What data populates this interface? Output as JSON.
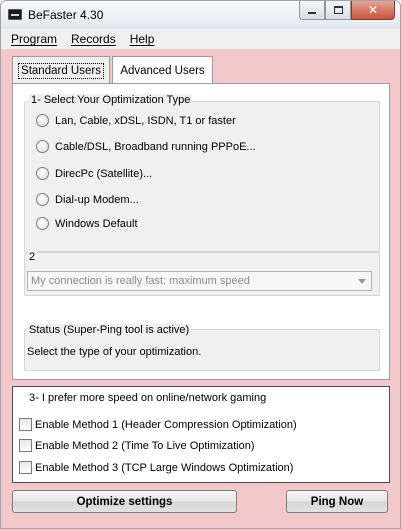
{
  "window": {
    "title": "BeFaster 4.30"
  },
  "menu": {
    "items": [
      "Program",
      "Records",
      "Help"
    ]
  },
  "tabs": [
    {
      "label": "Standard Users"
    },
    {
      "label": "Advanced Users"
    }
  ],
  "optimization": {
    "group_label": "1- Select Your Optimization Type",
    "options": [
      "Lan, Cable, xDSL, ISDN, T1 or faster",
      "Cable/DSL, Broadband running PPPoE...",
      "DirecPc (Satellite)...",
      "Dial-up Modem...",
      "Windows Default"
    ]
  },
  "connection": {
    "group_label": "2",
    "selected": "My connection is really fast: maximum speed"
  },
  "status": {
    "group_label": "Status  (Super-Ping tool is active)",
    "text": "Select the type of your optimization."
  },
  "gaming": {
    "group_label": "3- I prefer more speed on online/network gaming",
    "methods": [
      "Enable Method 1 (Header Compression Optimization)",
      "Enable Method 2 (Time To Live Optimization)",
      "Enable Method 3 (TCP Large Windows Optimization)"
    ]
  },
  "buttons": {
    "optimize": "Optimize settings",
    "ping": "Ping Now"
  },
  "colors": {
    "window_bg": "#f2c8cb",
    "close_button": "#c7553f"
  }
}
